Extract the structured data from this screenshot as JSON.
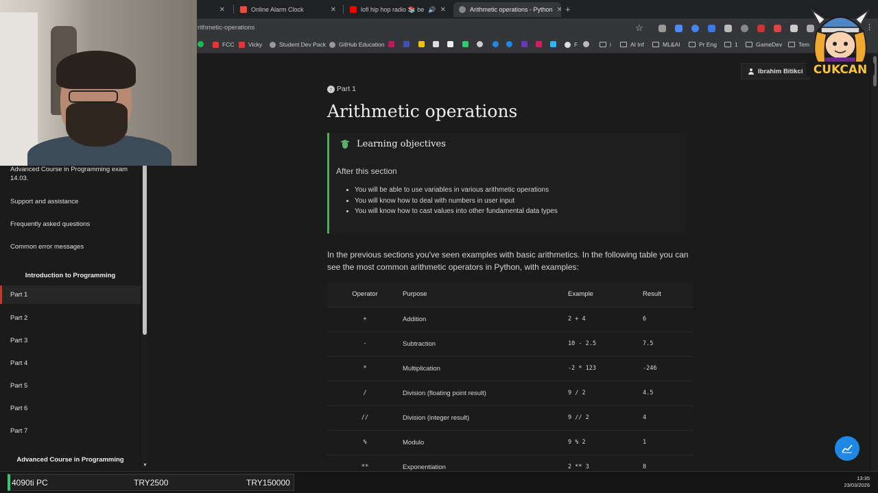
{
  "browser": {
    "tabs": [
      {
        "label": "Online Alarm Clock",
        "icon_color": "#e74c3c"
      },
      {
        "label": "lofi hip hop radio 📚 beats",
        "icon_color": "#ff0000"
      },
      {
        "label": "Arithmetic operations - Python",
        "icon_color": "#888888"
      }
    ],
    "url": "rithmetic-operations",
    "bookmarks": [
      "FCC",
      "Vicky",
      "Student Dev Pack",
      "GitHub Education",
      "F",
      "i",
      "AI Inf",
      "ML&AI",
      "Pr Eng",
      "1",
      "GameDev",
      "Tem"
    ]
  },
  "user": {
    "name": "Ibrahim Bitikci"
  },
  "sidebar": {
    "items_top": [
      "Advanced Course in Programming exam 14.03.",
      "Support and assistance",
      "Frequently asked questions",
      "Common error messages"
    ],
    "section1": "Introduction to Programming",
    "parts": [
      "Part 1",
      "Part 2",
      "Part 3",
      "Part 4",
      "Part 5",
      "Part 6",
      "Part 7"
    ],
    "active_part": "Part 1",
    "section2": "Advanced Course in Programming"
  },
  "main": {
    "part_link": "Part 1",
    "title": "Arithmetic operations",
    "objectives": {
      "title": "Learning objectives",
      "after": "After this section",
      "items": [
        "You will be able to use variables in various arithmetic operations",
        "You will know how to deal with numbers in user input",
        "You will know how to cast values into other fundamental data types"
      ]
    },
    "intro": "In the previous sections you've seen examples with basic arithmetics. In the following table you can see the most common arithmetic operators in Python, with examples:",
    "table": {
      "headers": [
        "Operator",
        "Purpose",
        "Example",
        "Result"
      ],
      "rows": [
        [
          "+",
          "Addition",
          "2 + 4",
          "6"
        ],
        [
          "-",
          "Subtraction",
          "10 - 2.5",
          "7.5"
        ],
        [
          "*",
          "Multiplication",
          "-2 * 123",
          "-246"
        ],
        [
          "/",
          "Division (floating point result)",
          "9 / 2",
          "4.5"
        ],
        [
          "//",
          "Division (integer result)",
          "9 // 2",
          "4"
        ],
        [
          "%",
          "Modulo",
          "9 % 2",
          "1"
        ],
        [
          "**",
          "Exponentiation",
          "2 ** 3",
          "8"
        ]
      ]
    }
  },
  "taskbar": {
    "ticker": {
      "label": "4090ti PC",
      "value1": "TRY2500",
      "value2": "TRY150000",
      "accent": "#2ecc71"
    },
    "time": "13:35",
    "date": "23/03/2026"
  },
  "overlay": {
    "mascot_text": "CUKCAN"
  },
  "colors": {
    "accent_green": "#4caf50",
    "active_red": "#c0392b",
    "fab_blue": "#1e88e5"
  }
}
